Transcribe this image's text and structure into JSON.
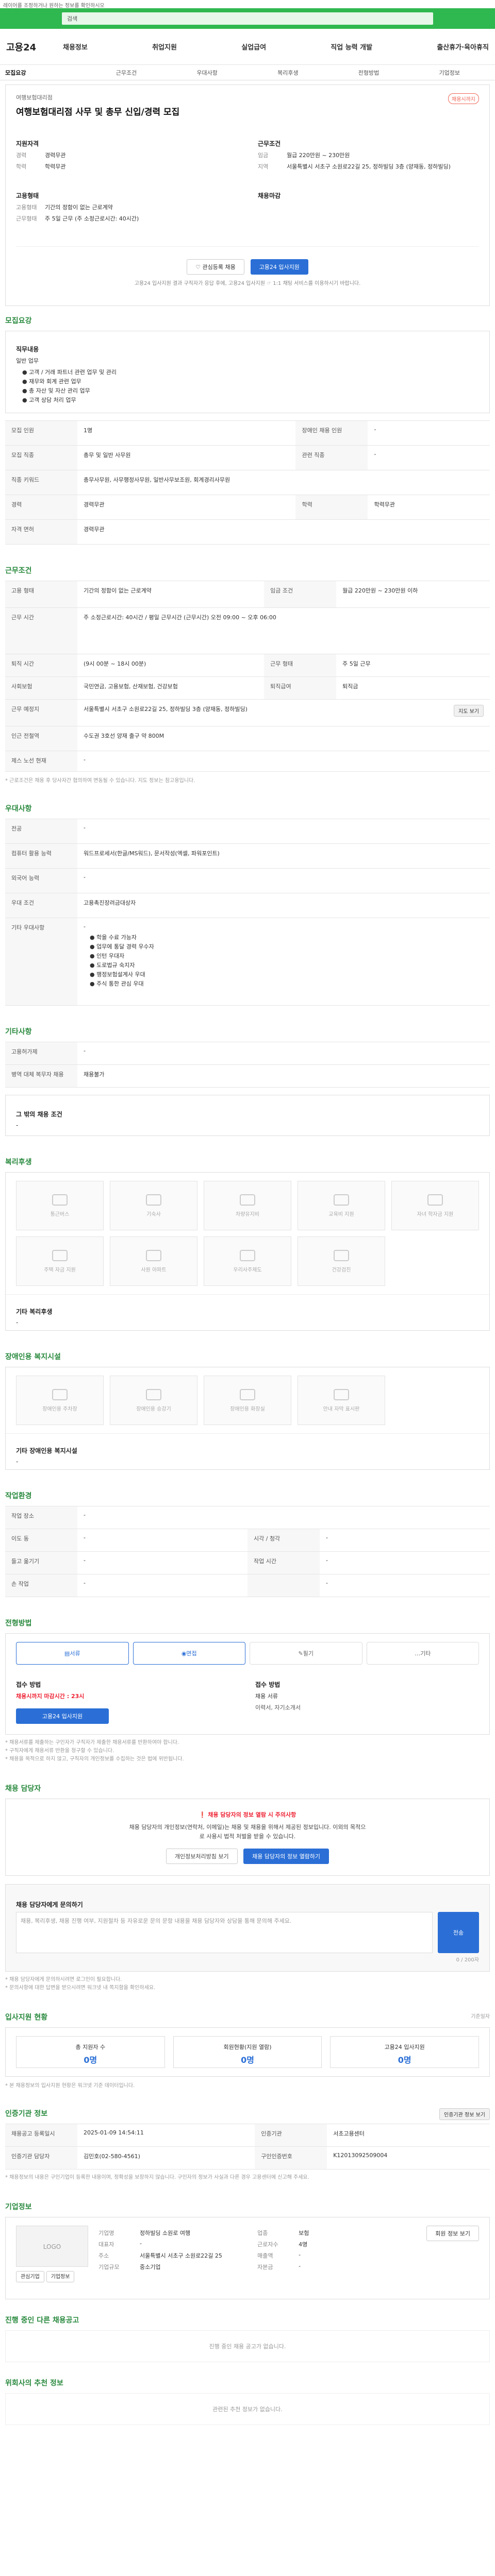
{
  "topnote": "레이어를 조정하거나 원하는 정보를 확인하시오",
  "search": {
    "placeholder": "검색"
  },
  "logo": "고용24",
  "menu": [
    "채용정보",
    "취업지원",
    "실업급여",
    "직업 능력 개발",
    "출산휴가·육아휴직"
  ],
  "tabs": [
    "모집요강",
    "근무조건",
    "우대사항",
    "복리후생",
    "전형방법",
    "기업정보"
  ],
  "header": {
    "org": "여행보험대리점",
    "title": "여행보험대리점 사무 및 총무 신입/경력 모집",
    "badge": "채용시까지",
    "left_title": "지원자격",
    "left": [
      {
        "k": "경력",
        "v": "경력무관"
      },
      {
        "k": "학력",
        "v": "학력무관"
      }
    ],
    "right_title": "근무조건",
    "right": [
      {
        "k": "임금",
        "v": "월급 220만원 ~ 230만원"
      },
      {
        "k": "지역",
        "v": "서울특별시 서초구 소원로22길 25, 정하빌딩 3층 (양재동, 정하빌딩)"
      }
    ],
    "left2_title": "고용형태",
    "left2": [
      {
        "k": "고용형태",
        "v": "기간의 정함이 없는 근로계약"
      },
      {
        "k": "근무형태",
        "v": "주 5일 근무 (주 소정근로시간: 40시간)"
      }
    ],
    "right2_title": "채용마감",
    "btn_scrap": "관심등록 채용",
    "btn_apply": "고용24 입사지원",
    "apply_note": "고용24 입사지원 결과 구직자가 응답 후에, 고용24 입사지원 ☞ 1:1 채팅 서비스를 이용하시기 바랍니다."
  },
  "recruit": {
    "title": "모집요강",
    "job_title": "직무내용",
    "job_desc": "일반 업무",
    "job_list": [
      "고객 / 거래 파트너 관련 업무 및 관리",
      "재무와 회계 관련 업무",
      "총 자산 및 자산 관리 업무",
      "고객 상담 처리 업무"
    ],
    "rows": [
      {
        "k": "모집 인원",
        "v": "1명",
        "k2": "장애인 채용 인원",
        "v2": "-"
      },
      {
        "k": "모집 직종",
        "v": "총무 및 일반 사무원",
        "k2": "관련 직종",
        "v2": "-"
      },
      {
        "k": "직종 키워드",
        "v": "총무사무원, 사무행정사무원, 일반사무보조원, 회계경리사무원",
        "k2": "",
        "v2": ""
      },
      {
        "k": "경력",
        "v": "경력무관",
        "k2": "학력",
        "v2": "학력무관"
      },
      {
        "k": "자격 면허",
        "v": "경력무관",
        "k2": "",
        "v2": ""
      }
    ]
  },
  "work": {
    "title": "근무조건",
    "rows": [
      {
        "k": "고용 형태",
        "v": "기간의 정함이 없는 근로계약",
        "k2": "임금 조건",
        "v2": "월급 220만원 ~ 230만원 이하"
      },
      {
        "k": "근무 시간",
        "v": "주 소정근로시간: 40시간 / 평일 근무시간 (근무시간) 오전 09:00 ~ 오후 06:00",
        "k2": "",
        "v2": ""
      },
      {
        "k": "퇴직 시간",
        "v": "(9시 00분 ~ 18시 00분)",
        "k2": "근무 형태",
        "v2": "주 5일 근무"
      },
      {
        "k": "사회보험",
        "v": "국민연금, 고용보험, 산재보험, 건강보험",
        "k2": "퇴직급여",
        "v2": "퇴직금"
      },
      {
        "k": "근무 예정지",
        "v": "서울특별시 서초구 소원로22길 25, 정하빌딩 3층 (양재동, 정하빌딩)",
        "k2": "",
        "v2": ""
      },
      {
        "k": "인근 전철역",
        "v": "수도권 3호선 양재 출구 약 800M",
        "k2": "",
        "v2": ""
      },
      {
        "k": "제스 노선 현재",
        "v": "-",
        "k2": "",
        "v2": ""
      }
    ],
    "map_btn": "지도 보기",
    "note": "* 근로조건은 채용 후 당사자간 협의하여 변동될 수 있습니다. 지도 정보는 참고용입니다."
  },
  "prefer": {
    "title": "우대사항",
    "rows": [
      {
        "k": "전공",
        "v": "-"
      },
      {
        "k": "컴퓨터 활용 능력",
        "v": "워드프로세서(한글/MS워드), 문서작성(엑셀, 파워포인트)"
      },
      {
        "k": "외국어 능력",
        "v": "-"
      },
      {
        "k": "우대 조건",
        "v": "고용촉진장려금대상자"
      },
      {
        "k": "기타 우대사항",
        "v": "-"
      }
    ],
    "etc_list": [
      "학을 수료 가능자",
      "업무에 통달 경력 우수자",
      "인턴 우대자",
      "도로법규 숙지자",
      "행정보험설계사 우대",
      "주식 통한 관심 우대"
    ]
  },
  "other": {
    "title": "기타사항",
    "rows": [
      {
        "k": "고용허가제",
        "v": "-"
      },
      {
        "k": "병역 대체 복무자 채용",
        "v": "채용불가"
      }
    ],
    "extra_title": "그 밖의 채용 조건",
    "extra_value": "-"
  },
  "welfare": {
    "title": "복리후생",
    "items": [
      "통근버스",
      "기숙사",
      "차량유지비",
      "교육비 지원",
      "자녀 학자금 지원",
      "주택 자금 지원",
      "사원 아파트",
      "우리사주제도",
      "건강검진"
    ],
    "sub_title": "기타 복리후생",
    "sub_value": "-"
  },
  "disabled": {
    "title": "장애인용 복지시설",
    "items": [
      "장애인용 주차장",
      "장애인용 승강기",
      "장애인용 화장실",
      "안내 자막 표시판"
    ],
    "sub_title": "기타 장애인용 복지시설",
    "sub_value": "-"
  },
  "env": {
    "title": "작업환경",
    "rows": [
      {
        "k": "작업 장소",
        "v": "-",
        "k2": "",
        "v2": ""
      },
      {
        "k": "이도 동",
        "v": "-",
        "k2": "시각 / 청각",
        "v2": "-"
      },
      {
        "k": "들고 옮기기",
        "v": "-",
        "k2": "작업 시간",
        "v2": "-"
      },
      {
        "k": "손 작업",
        "v": "-",
        "k2": "",
        "v2": "-"
      }
    ]
  },
  "process": {
    "title": "전형방법",
    "steps": [
      "서류",
      "면접",
      "필기",
      "기타"
    ],
    "left_title": "접수 방법",
    "left_value": "채용시까지 마감시간 : 23시",
    "left_btn": "고용24 입사지원",
    "right_title": "접수 방법",
    "right_value": "채용 서류",
    "right_items": "이력서, 자기소개서",
    "notes": [
      "* 채용서류를 제출하는 구인자가 구직자가 제출한 채용서류를 반환하여야 합니다.",
      "* 구직자에게 채용서류 반환을 청구할 수 있습니다.",
      "* 채용을 목적으로 하지 않고, 구직자의 개인정보를 수집하는 것은 법에 위반됩니다."
    ]
  },
  "contact": {
    "title": "채용 담당자",
    "warn_title": "채용 담당자의 정보 열람 시 주의사항",
    "warn_text": "채용 담당자의 개인정보(연락처, 이메일)는 채용 및 채용을 위해서 제공된 정보입니다. 이외의 목적으로 사용시 법적 처벌을 받을 수 있습니다.",
    "btn1": "개인정보처리방침 보기",
    "btn2": "채용 담당자의 정보 열람하기",
    "inq_title": "채용 담당자에게 문의하기",
    "inq_placeholder": "채용, 복리후생, 채용 진행 여부, 지원절차 등 자유로운 문의 문항 내용을 채용 담당자와 상담을 통해 문의해 주세요.",
    "inq_count": "0 / 200자",
    "inq_btn": "전송",
    "inq_notes": [
      "* 채용 담당자에게 문의하시려면 로그인이 필요합니다.",
      "* 문의사항에 대한 답변을 받으시려면 워크넷 내 쪽지함을 확인하세요."
    ]
  },
  "apply": {
    "title": "입사지원 현황",
    "pageinfo": "기준일자 ",
    "stats": [
      {
        "k": "총 지원자 수",
        "v": "0명"
      },
      {
        "k": "회원현황(지원 열람)",
        "v": "0명"
      },
      {
        "k": "고용24 입사지원",
        "v": "0명"
      }
    ],
    "note": "* 본 채용정보의 입사지원 현황은 워크넷 기준 데이터입니다."
  },
  "certify": {
    "title": "인증기관 정보",
    "btn": "인증기관 정보 보기",
    "rows": [
      {
        "k": "채용공고 등록일시",
        "v": "2025-01-09 14:54:11",
        "k2": "인증기관",
        "v2": "서초고용센터"
      },
      {
        "k": "인증기관 담당자",
        "v": "김민호(02-580-4561)",
        "k2": "구인인증번호",
        "v2": "K12013092509004"
      }
    ],
    "note": "* 채용정보의 내용은 구인기업이 등록한 내용이며, 정확성을 보장하지 않습니다. 구인자의 정보가 사실과 다른 경우 고용센터에 신고해 주세요."
  },
  "company": {
    "title": "기업정보",
    "logo_label": "LOGO",
    "btn1": "관심기업",
    "btn2": "기업정보",
    "rows": [
      {
        "k": "기업명",
        "v": "정하빌딩 소원로 여행",
        "k2": "업종",
        "v2": "보험"
      },
      {
        "k": "대표자",
        "v": "-",
        "k2": "근로자수",
        "v2": "4명"
      },
      {
        "k": "주소",
        "v": "서울특별시 서초구 소원로22길 25",
        "k2": "매출액",
        "v2": "-"
      },
      {
        "k": "기업규모",
        "v": "중소기업",
        "k2": "자본금",
        "v2": "-"
      }
    ],
    "right_btn": "회원 정보 보기"
  },
  "others": {
    "title": "진행 중인 다른 채용공고",
    "empty": "진행 중인 채용 공고가 없습니다.",
    "rec_title": "위회사의 추천 정보",
    "rec_empty": "관련된 추천 정보가 없습니다."
  }
}
